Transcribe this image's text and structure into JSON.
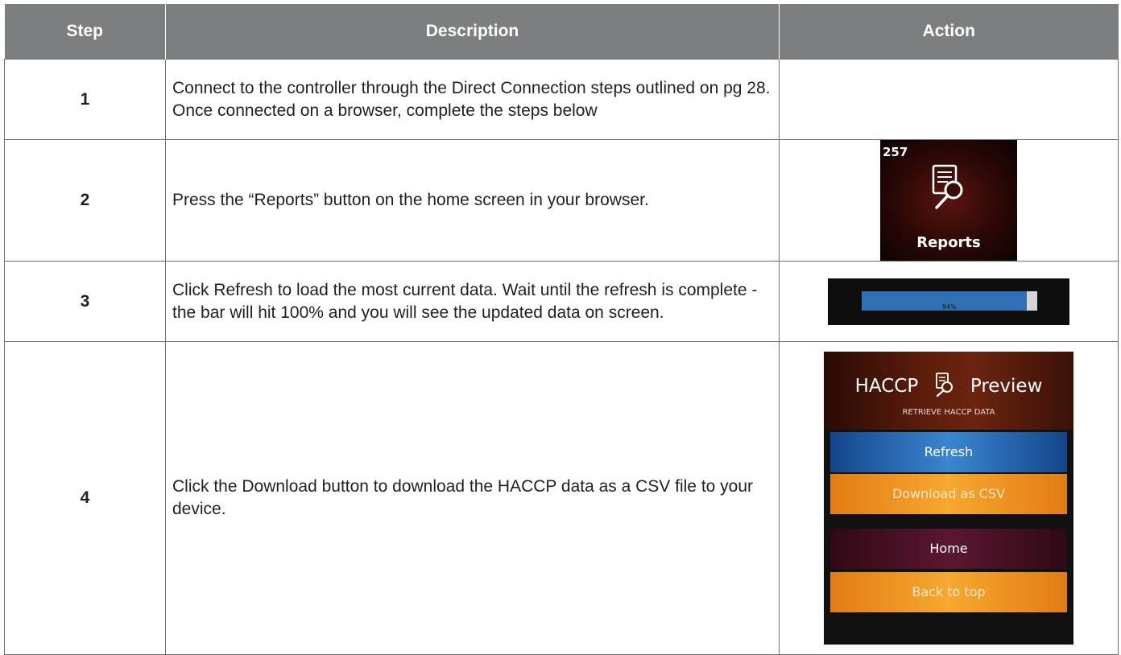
{
  "table": {
    "headers": {
      "step": "Step",
      "description": "Description",
      "action": "Action"
    },
    "rows": [
      {
        "step": "1",
        "description": "Connect to the controller through the Direct Connection steps outlined on pg 28. Once connected on a browser, complete the steps below"
      },
      {
        "step": "2",
        "description": "Press the “Reports” button on the home screen in your browser."
      },
      {
        "step": "3",
        "description": "Click Refresh to load the most current data. Wait until the refresh is complete - the bar will hit 100% and you will see the updated data on screen."
      },
      {
        "step": "4",
        "description": "Click the Download button to download the HACCP data as a CSV file to your device."
      }
    ]
  },
  "reports_tile": {
    "count": "257",
    "label": "Reports",
    "icon": "report-search-icon"
  },
  "progress": {
    "value": 0.94,
    "text": "94%"
  },
  "haccp_panel": {
    "title_left": "HACCP",
    "title_right": "Preview",
    "subtitle": "RETRIEVE HACCP DATA",
    "icon": "report-search-icon",
    "buttons": {
      "refresh": "Refresh",
      "download": "Download as CSV",
      "home": "Home",
      "back_to_top": "Back to top"
    }
  },
  "colors": {
    "header_bg": "#7d7e80",
    "border": "#6d6e71",
    "refresh_blue": "#2f6fb3",
    "download_orange": "#f39a25"
  }
}
